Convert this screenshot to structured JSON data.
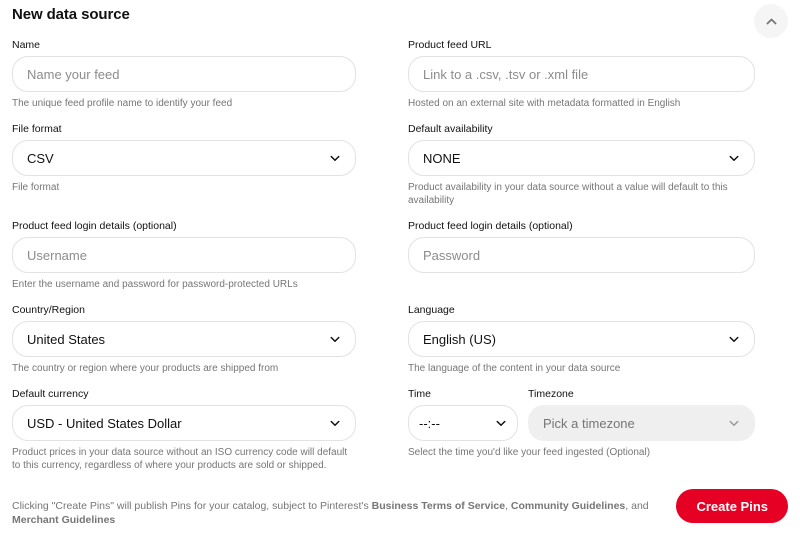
{
  "header": {
    "title": "New data source",
    "collapse_icon": "chevron-up-icon"
  },
  "colors": {
    "brand_red": "#e60023",
    "border": "#e2e2e2",
    "helper_text": "#767676",
    "disabled_bg": "#efefef"
  },
  "fields": {
    "name": {
      "label": "Name",
      "placeholder": "Name your feed",
      "value": "",
      "helper": "The unique feed profile name to identify your feed"
    },
    "product_feed_url": {
      "label": "Product feed URL",
      "placeholder": "Link to a .csv, .tsv or .xml file",
      "value": "",
      "helper": "Hosted on an external site with metadata formatted in English"
    },
    "file_format": {
      "label": "File format",
      "value": "CSV",
      "helper": "File format",
      "icon": "chevron-down-icon"
    },
    "default_availability": {
      "label": "Default availability",
      "value": "NONE",
      "helper": "Product availability in your data source without a value will default to this availability",
      "icon": "chevron-down-icon"
    },
    "feed_username": {
      "label": "Product feed login details (optional)",
      "placeholder": "Username",
      "value": "",
      "helper": "Enter the username and password for password-protected URLs"
    },
    "feed_password": {
      "label": "Product feed login details (optional)",
      "placeholder": "Password",
      "value": "",
      "helper": ""
    },
    "country_region": {
      "label": "Country/Region",
      "value": "United States",
      "helper": "The country or region where your products are shipped from",
      "icon": "chevron-down-icon"
    },
    "language": {
      "label": "Language",
      "value": "English (US)",
      "helper": "The language of the content in your data source",
      "icon": "chevron-down-icon"
    },
    "default_currency": {
      "label": "Default currency",
      "value": "USD - United States Dollar",
      "helper": "Product prices in your data source without an ISO currency code will default to this currency, regardless of where your products are sold or shipped.",
      "icon": "chevron-down-icon"
    },
    "time": {
      "label": "Time",
      "value": "--:--",
      "helper": "Select the time you'd like your feed ingested (Optional)",
      "icon": "chevron-down-icon"
    },
    "timezone": {
      "label": "Timezone",
      "value": "Pick a timezone",
      "disabled": true,
      "icon": "chevron-down-icon"
    }
  },
  "footer": {
    "legal_prefix": "Clicking \"Create Pins\" will publish Pins for your catalog, subject to Pinterest's ",
    "link_terms": "Business Terms of Service",
    "legal_sep1": ", ",
    "link_community": "Community Guidelines",
    "legal_sep2": ", and ",
    "link_merchant": "Merchant Guidelines",
    "submit_label": "Create Pins"
  }
}
